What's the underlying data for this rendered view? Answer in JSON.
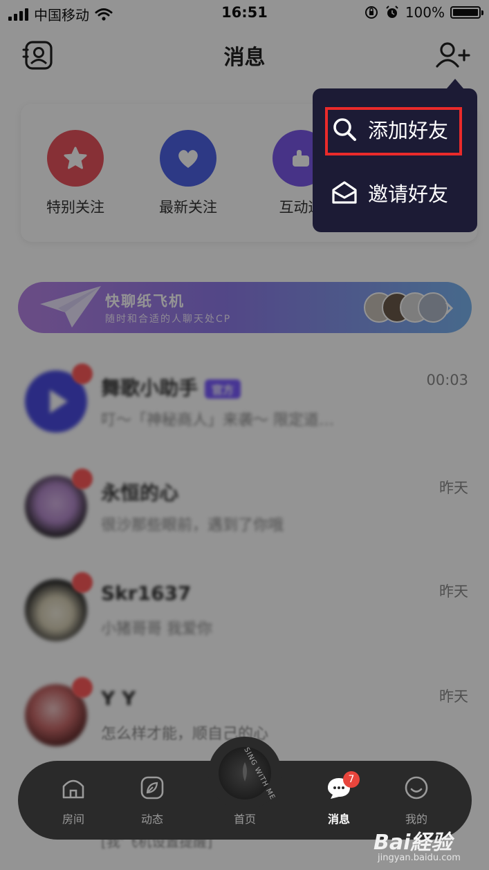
{
  "status_bar": {
    "carrier": "中国移动",
    "time": "16:51",
    "battery_percent": "100%",
    "battery_level": 1.0
  },
  "header": {
    "title": "消息",
    "left_icon": "contacts-icon",
    "right_icon": "add-user-icon"
  },
  "quick_actions": [
    {
      "label": "特别关注",
      "icon": "star-icon",
      "color": "#e8545e"
    },
    {
      "label": "最新关注",
      "icon": "heart-icon",
      "color": "#4e63e6"
    },
    {
      "label": "互动通",
      "icon": "thumb-icon",
      "color": "#7a58e8"
    }
  ],
  "banner": {
    "title": "快聊纸飞机",
    "subtitle": "随时和合适的人聊天处CP"
  },
  "chats": [
    {
      "name": "舞歌小助手",
      "tag": "官方",
      "preview": "叮～「神秘商人」来袭～ 限定道…",
      "time": "00:03"
    },
    {
      "name": "永恒的心",
      "tag": "",
      "preview": "很沙那些眼前，遇到了你哦",
      "time": "昨天"
    },
    {
      "name": "Skr1637",
      "tag": "",
      "preview": "小猪哥哥 我爱你",
      "time": "昨天"
    },
    {
      "name": "Y Y",
      "tag": "",
      "preview": "怎么样才能，顺自己的心",
      "time": "昨天"
    }
  ],
  "behind_tabbar_preview": "[我'飞机设置提醒]",
  "popup_menu": {
    "items": [
      {
        "label": "添加好友",
        "icon": "search-icon"
      },
      {
        "label": "邀请好友",
        "icon": "envelope-icon"
      }
    ],
    "highlight_color": "#ea2a2a"
  },
  "tabbar": {
    "tabs": [
      {
        "label": "房间",
        "icon": "house-icon"
      },
      {
        "label": "动态",
        "icon": "leaf-icon"
      },
      {
        "label": "首页",
        "icon": "vinyl-icon"
      },
      {
        "label": "消息",
        "icon": "chat-bubble-icon",
        "badge": "7",
        "active": true
      },
      {
        "label": "我的",
        "icon": "smile-icon"
      }
    ],
    "center_ring_text": "SING WITH ME"
  },
  "watermark": {
    "logo": "Bai経验",
    "url": "jingyan.baidu.com"
  }
}
